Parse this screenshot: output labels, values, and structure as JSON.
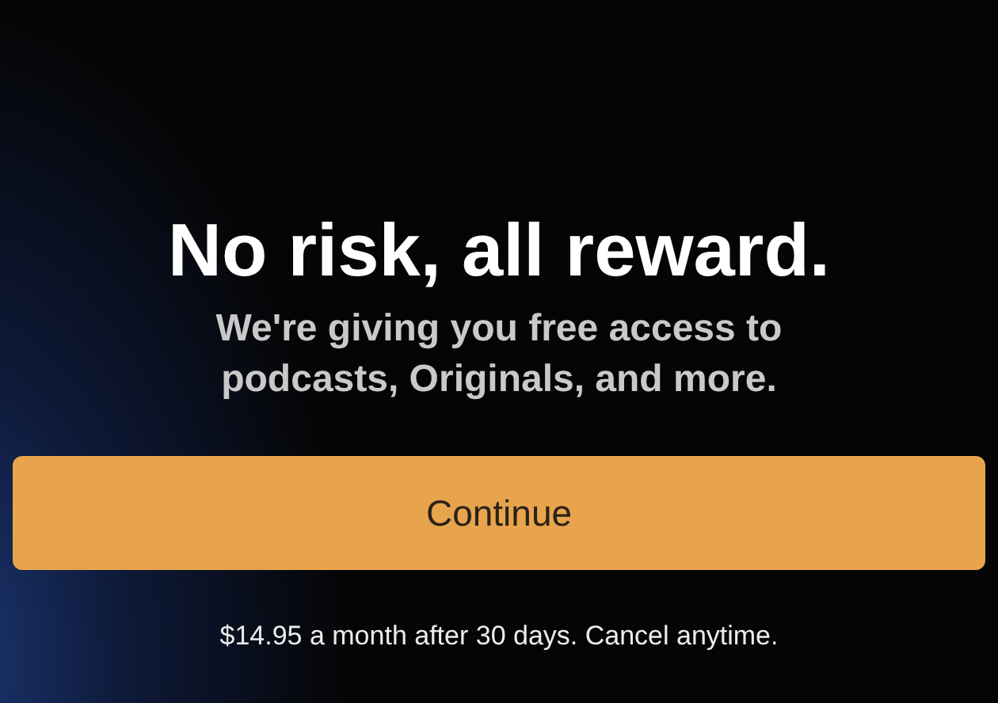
{
  "heading": "No risk, all reward.",
  "subtitle": "We're giving you free access to podcasts, Originals, and more.",
  "continue_button": {
    "label": "Continue"
  },
  "footnote": "$14.95 a month after 30 days. Cancel anytime."
}
